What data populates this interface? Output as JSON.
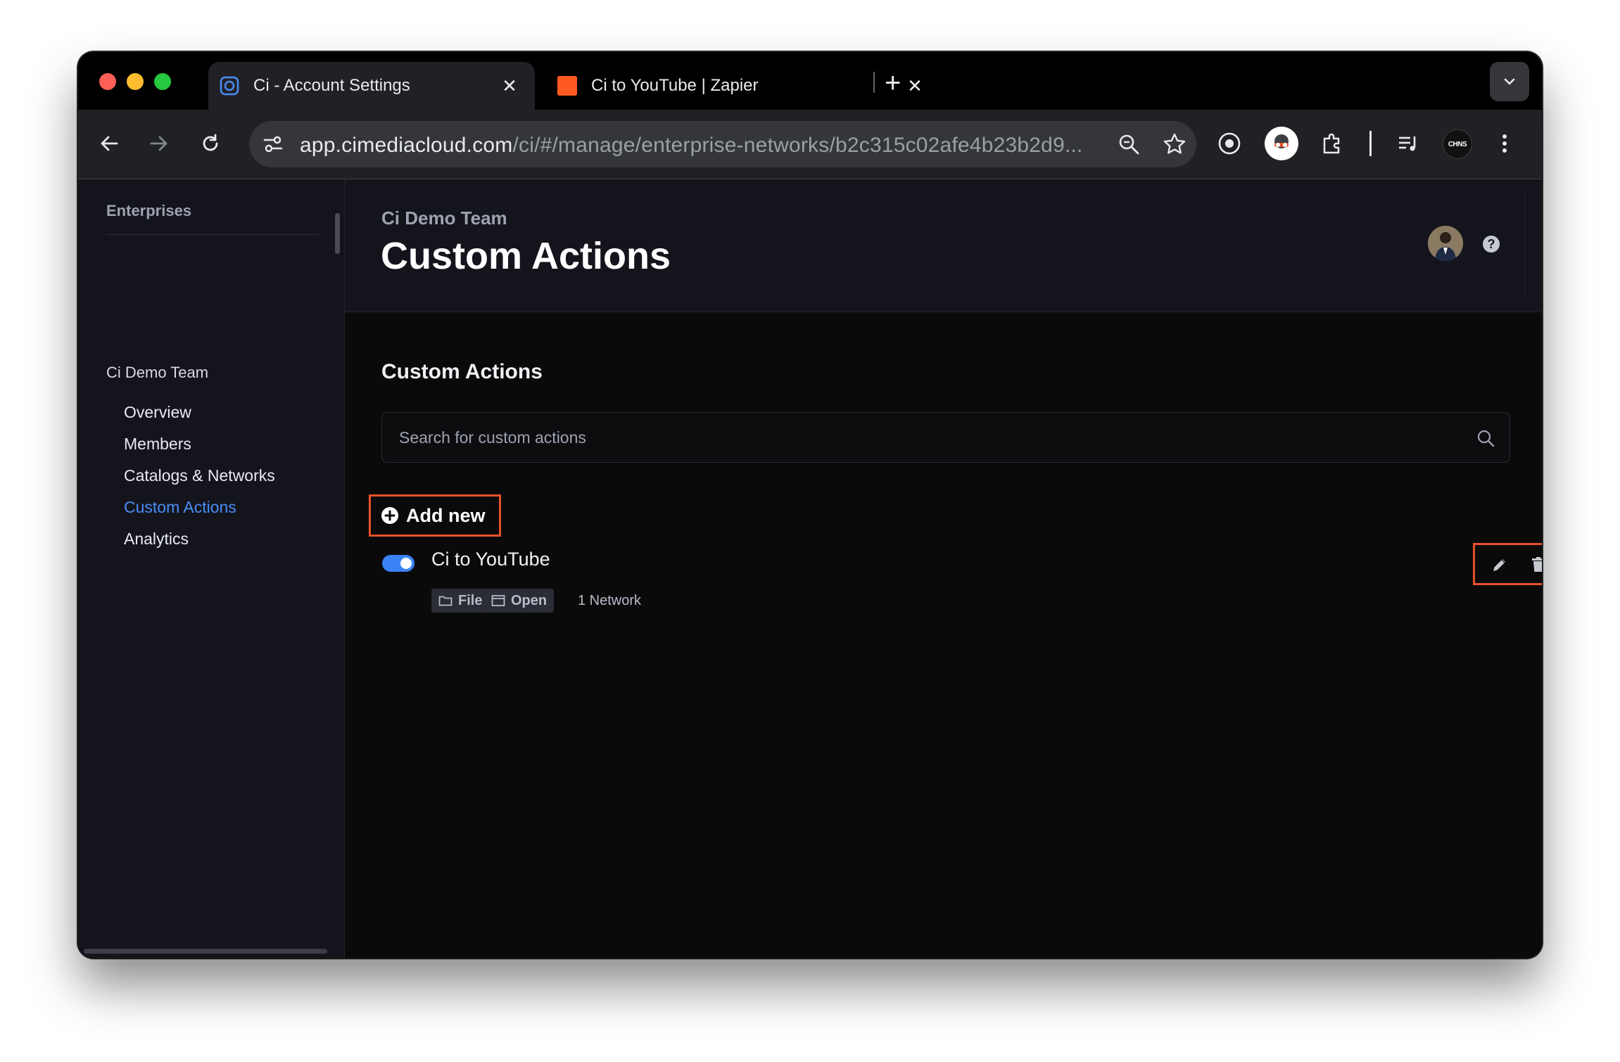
{
  "browser": {
    "tabs": [
      {
        "title": "Ci - Account Settings",
        "active": true,
        "favicon": "ci-favicon-icon"
      },
      {
        "title": "Ci to YouTube | Zapier",
        "active": false,
        "favicon": "zapier-favicon-icon"
      }
    ],
    "url_host": "app.cimediacloud.com",
    "url_path": "/ci/#/manage/enterprise-networks/b2c315c02afe4b23b2d9...",
    "profile_badge": "CHNS"
  },
  "sidebar": {
    "section_label": "Enterprises",
    "team_name": "Ci Demo Team",
    "items": [
      {
        "label": "Overview",
        "active": false
      },
      {
        "label": "Members",
        "active": false
      },
      {
        "label": "Catalogs & Networks",
        "active": false
      },
      {
        "label": "Custom Actions",
        "active": true
      },
      {
        "label": "Analytics",
        "active": false
      }
    ]
  },
  "header": {
    "breadcrumb": "Ci Demo Team",
    "title": "Custom Actions",
    "help_glyph": "?"
  },
  "main": {
    "section_title": "Custom Actions",
    "search_placeholder": "Search for custom actions",
    "add_button_label": "Add new",
    "actions": [
      {
        "name": "Ci to YouTube",
        "enabled": true,
        "tags": [
          "File",
          "Open"
        ],
        "network_count": "1 Network"
      }
    ]
  },
  "colors": {
    "accent": "#4a8df8",
    "highlight_border": "#e8502a",
    "sidebar_bg": "#14151c",
    "main_bg": "#0a0a0b"
  }
}
